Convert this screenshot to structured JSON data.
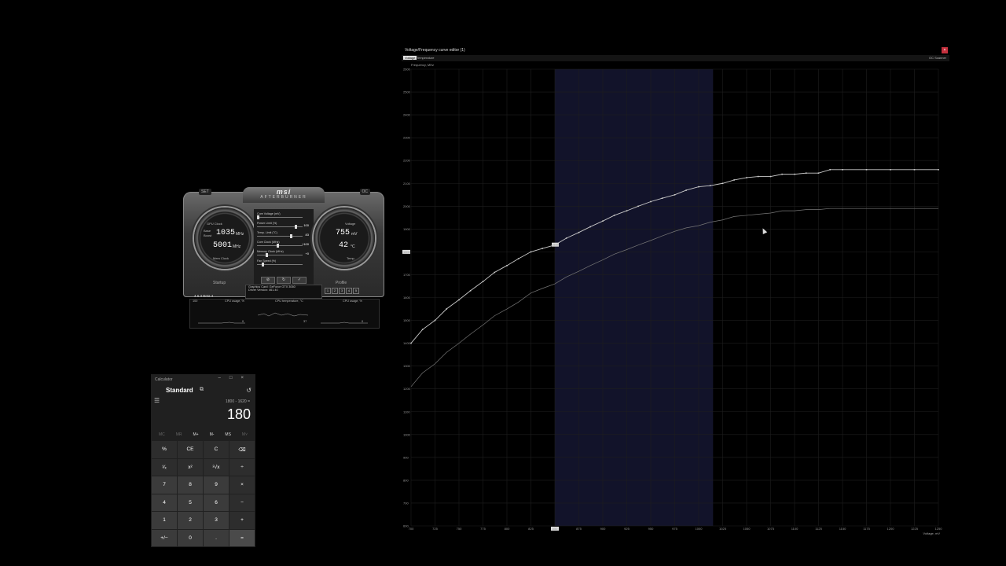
{
  "afterburner": {
    "logo": "msi",
    "subtitle": "AFTERBURNER",
    "left_corner": "SET",
    "right_corner": "OC",
    "gpu_clock_label": "GPU Clock",
    "base_label": "Base",
    "boost_label": "Boost",
    "gpu_clock_value": "1035",
    "gpu_clock_unit": "MHz",
    "mem_clock_value": "5001",
    "mem_clock_unit": "MHz",
    "mem_clock_label": "Mem Clock",
    "voltage_label": "Voltage",
    "voltage_value": "755",
    "voltage_unit": "mV",
    "temp_value": "42",
    "temp_unit": "°C",
    "temp_label": "Temp.",
    "sliders": [
      {
        "name": "Core Voltage (mV)",
        "value": ""
      },
      {
        "name": "Power Limit (%)",
        "value": "100"
      },
      {
        "name": "Temp. Limit (°C)",
        "value": "83"
      },
      {
        "name": "Core Clock (MHz)",
        "value": "+100"
      },
      {
        "name": "Memory Clock (MHz)",
        "value": "+0"
      },
      {
        "name": "Fan Speed (%)",
        "value": ""
      }
    ],
    "slider_levels": [
      0,
      0.85,
      0.75,
      0.45,
      0.2,
      0.1
    ],
    "startup_label": "Startup",
    "profile_label": "Profile",
    "graphics_card_label": "Graphics Card:",
    "graphics_card_value": "GeForce GTX 3060",
    "driver_label": "Driver Version:",
    "driver_value": "461.40",
    "version": "4.6.3 Beta 4",
    "monitor_titles": [
      "CPU usage, %",
      "CPU temperature, °C",
      "CPU usage, %"
    ],
    "monitor_mins": [
      "0",
      "37",
      "0"
    ],
    "monitor_max": "100",
    "profile_slots": [
      "1",
      "2",
      "3",
      "4",
      "5"
    ]
  },
  "calculator": {
    "title": "Calculator",
    "mode": "Standard",
    "expression": "1800 - 1620 =",
    "result": "180",
    "memory": [
      {
        "label": "MC",
        "enabled": false
      },
      {
        "label": "MR",
        "enabled": false
      },
      {
        "label": "M+",
        "enabled": true
      },
      {
        "label": "M-",
        "enabled": true
      },
      {
        "label": "MS",
        "enabled": true
      },
      {
        "label": "M˅",
        "enabled": false
      }
    ],
    "keys": [
      {
        "label": "%",
        "type": "op"
      },
      {
        "label": "CE",
        "type": "op"
      },
      {
        "label": "C",
        "type": "op"
      },
      {
        "label": "⌫",
        "type": "op"
      },
      {
        "label": "¹⁄ₓ",
        "type": "op"
      },
      {
        "label": "x²",
        "type": "op"
      },
      {
        "label": "²√x",
        "type": "op"
      },
      {
        "label": "÷",
        "type": "op"
      },
      {
        "label": "7",
        "type": "num"
      },
      {
        "label": "8",
        "type": "num"
      },
      {
        "label": "9",
        "type": "num"
      },
      {
        "label": "×",
        "type": "op"
      },
      {
        "label": "4",
        "type": "num"
      },
      {
        "label": "5",
        "type": "num"
      },
      {
        "label": "6",
        "type": "num"
      },
      {
        "label": "−",
        "type": "op"
      },
      {
        "label": "1",
        "type": "num"
      },
      {
        "label": "2",
        "type": "num"
      },
      {
        "label": "3",
        "type": "num"
      },
      {
        "label": "+",
        "type": "op"
      },
      {
        "label": "+/−",
        "type": "num"
      },
      {
        "label": "0",
        "type": "num"
      },
      {
        "label": ".",
        "type": "num"
      },
      {
        "label": "=",
        "type": "eq"
      }
    ]
  },
  "vf_editor": {
    "title": "Voltage/Frequency curve editor (1)",
    "tabs": [
      "Voltage",
      "Temperature"
    ],
    "active_tab": 0,
    "scanner_label": "OC Scanner",
    "y_axis_label": "Frequency, MHz",
    "x_axis_label": "Voltage, mV",
    "close_glyph": "×",
    "colors": {
      "curve": "#c8c8c8",
      "default_curve": "#777777",
      "selection": "#12132a",
      "grid": "#1e1e1e"
    }
  },
  "chart_data": {
    "type": "line",
    "xlim": [
      700,
      1250
    ],
    "ylim": [
      600,
      2600
    ],
    "x_ticks": [
      700,
      725,
      750,
      775,
      800,
      825,
      850,
      875,
      900,
      925,
      950,
      975,
      1000,
      1025,
      1050,
      1075,
      1100,
      1125,
      1150,
      1175,
      1200,
      1225,
      1250
    ],
    "y_ticks": [
      600,
      700,
      800,
      900,
      1000,
      1100,
      1200,
      1300,
      1400,
      1500,
      1600,
      1700,
      1800,
      1900,
      2000,
      2100,
      2200,
      2300,
      2400,
      2500,
      2600
    ],
    "selection_range": [
      850,
      1015
    ],
    "selected_point": {
      "x": 850,
      "y": 1830
    },
    "highlight_x_tick": "850",
    "highlight_y_tick": "1800",
    "selected_label": "1830",
    "grid": true,
    "series": [
      {
        "x": [
          700,
          712,
          725,
          737,
          750,
          762,
          775,
          787,
          800,
          812,
          825,
          837,
          850,
          862,
          875,
          887,
          900,
          912,
          925,
          937,
          950,
          962,
          975,
          987,
          1000,
          1012,
          1025,
          1037,
          1050,
          1062,
          1075,
          1087,
          1100,
          1112,
          1125,
          1137,
          1150,
          1175,
          1200,
          1225,
          1250
        ],
        "y": [
          1400,
          1460,
          1500,
          1550,
          1590,
          1630,
          1670,
          1710,
          1740,
          1770,
          1800,
          1815,
          1830,
          1860,
          1885,
          1910,
          1935,
          1960,
          1980,
          2000,
          2020,
          2035,
          2050,
          2070,
          2085,
          2090,
          2100,
          2115,
          2125,
          2130,
          2130,
          2140,
          2140,
          2145,
          2145,
          2160,
          2160,
          2160,
          2160,
          2160,
          2160
        ]
      },
      {
        "x": [
          700,
          712,
          725,
          737,
          750,
          762,
          775,
          787,
          800,
          812,
          825,
          837,
          850,
          862,
          875,
          887,
          900,
          912,
          925,
          937,
          950,
          962,
          975,
          987,
          1000,
          1012,
          1025,
          1037,
          1050,
          1062,
          1075,
          1087,
          1100,
          1112,
          1125,
          1137,
          1150,
          1175,
          1200,
          1225,
          1250
        ],
        "y": [
          1210,
          1270,
          1310,
          1360,
          1400,
          1440,
          1480,
          1520,
          1550,
          1580,
          1620,
          1640,
          1660,
          1690,
          1715,
          1740,
          1765,
          1790,
          1810,
          1830,
          1850,
          1870,
          1890,
          1905,
          1915,
          1930,
          1940,
          1955,
          1960,
          1965,
          1970,
          1980,
          1980,
          1985,
          1985,
          1990,
          1990,
          1990,
          1990,
          1990,
          1990
        ]
      }
    ]
  }
}
